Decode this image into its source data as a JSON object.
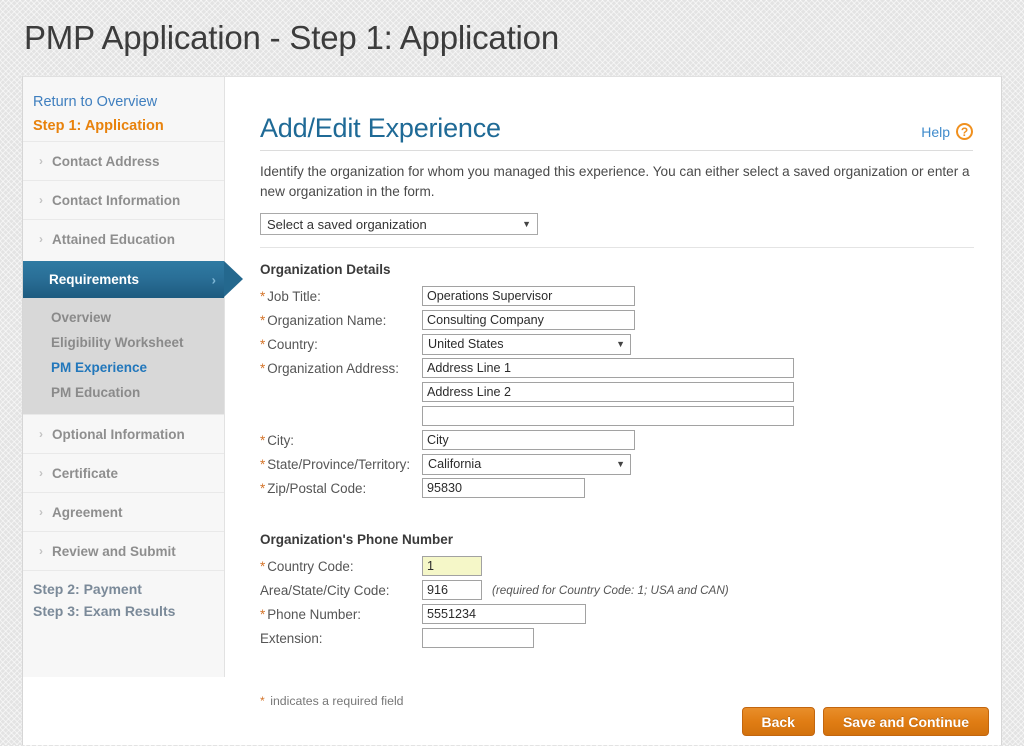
{
  "header": {
    "title": "PMP Application - Step 1: Application"
  },
  "sidebar": {
    "return_link": "Return to Overview",
    "current_step": "Step 1: Application",
    "groups": [
      {
        "label": "Contact Address"
      },
      {
        "label": "Contact Information"
      },
      {
        "label": "Attained Education"
      }
    ],
    "active_group": "Requirements",
    "sub_items": [
      {
        "label": "Overview",
        "active": false
      },
      {
        "label": "Eligibility Worksheet",
        "active": false
      },
      {
        "label": "PM Experience",
        "active": true
      },
      {
        "label": "PM Education",
        "active": false
      }
    ],
    "groups_after": [
      {
        "label": "Optional Information"
      },
      {
        "label": "Certificate"
      },
      {
        "label": "Agreement"
      },
      {
        "label": "Review and Submit"
      }
    ],
    "steps_tail": [
      {
        "label": "Step 2: Payment"
      },
      {
        "label": "Step 3: Exam Results"
      }
    ],
    "chevron_icon": "›"
  },
  "content": {
    "title": "Add/Edit Experience",
    "help_label": "Help",
    "help_icon": "?",
    "intro": "Identify the organization for whom you managed this experience. You can either select a saved organization or enter a new organization in the form.",
    "saved_org_select": "Select a saved organization",
    "caret_icon": "▼",
    "org_details_title": "Organization Details",
    "fields": [
      {
        "label": "Job Title:",
        "required": true,
        "value": "Operations Supervisor",
        "type": "text",
        "width": "w-med"
      },
      {
        "label": "Organization Name:",
        "required": true,
        "value": "Consulting Company",
        "type": "text",
        "width": "w-med"
      },
      {
        "label": "Country:",
        "required": true,
        "value": "United States",
        "type": "select",
        "width": "w-sel"
      },
      {
        "label": "Organization Address:",
        "required": true,
        "value": "Address Line 1",
        "type": "text",
        "width": "w-wide"
      },
      {
        "label": "",
        "required": false,
        "value": "Address Line 2",
        "type": "text",
        "width": "w-wide"
      },
      {
        "label": "",
        "required": false,
        "value": "",
        "type": "text",
        "width": "w-wide"
      },
      {
        "label": "City:",
        "required": true,
        "value": "City",
        "type": "text",
        "width": "w-med"
      },
      {
        "label": "State/Province/Territory:",
        "required": true,
        "value": "California",
        "type": "select",
        "width": "w-sel"
      },
      {
        "label": "Zip/Postal Code:",
        "required": true,
        "value": "95830",
        "type": "text",
        "width": "w-zip"
      }
    ],
    "phone_title": "Organization's Phone Number",
    "phone_fields": [
      {
        "label": "Country Code:",
        "required": true,
        "value": "1",
        "width": "w-cc",
        "highlight": true,
        "note": ""
      },
      {
        "label": "Area/State/City Code:",
        "required": false,
        "value": "916",
        "width": "w-area",
        "highlight": false,
        "note": "(required for Country Code: 1; USA and CAN)"
      },
      {
        "label": "Phone Number:",
        "required": true,
        "value": "5551234",
        "width": "w-phone",
        "highlight": false,
        "note": ""
      },
      {
        "label": "Extension:",
        "required": false,
        "value": "",
        "width": "w-ext",
        "highlight": false,
        "note": ""
      }
    ],
    "required_note": "indicates a required field",
    "required_marker": "*",
    "back_button": "Back",
    "continue_button": "Save and Continue"
  },
  "colors": {
    "accent_orange": "#e8820c",
    "link_blue": "#3f7fbf",
    "active_nav_blue": "#24688e",
    "title_blue": "#1f6a96",
    "required_star": "#d4742a",
    "highlight_yellow": "#f5f7c8"
  }
}
